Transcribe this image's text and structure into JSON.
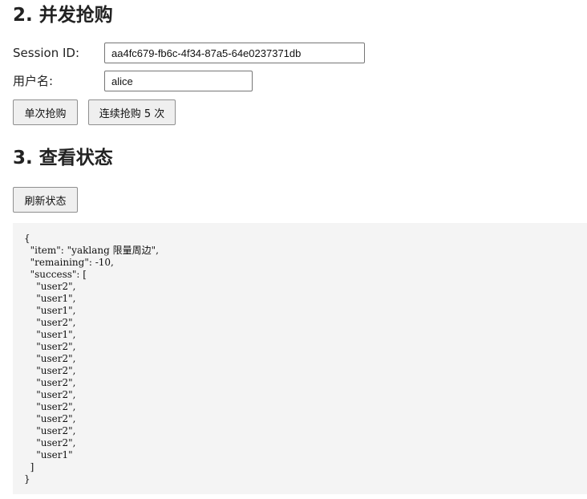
{
  "section2": {
    "title": "2. 并发抢购",
    "session_label": "Session ID:",
    "session_value": "aa4fc679-fb6c-4f34-87a5-64e0237371db",
    "username_label": "用户名:",
    "username_value": "alice",
    "single_buy_button": "单次抢购",
    "multi_buy_button": "连续抢购 5 次"
  },
  "section3": {
    "title": "3. 查看状态",
    "refresh_button": "刷新状态",
    "output": "{\n  \"item\": \"yaklang 限量周边\",\n  \"remaining\": -10,\n  \"success\": [\n    \"user2\",\n    \"user1\",\n    \"user1\",\n    \"user2\",\n    \"user1\",\n    \"user2\",\n    \"user2\",\n    \"user2\",\n    \"user2\",\n    \"user2\",\n    \"user2\",\n    \"user2\",\n    \"user2\",\n    \"user2\",\n    \"user1\"\n  ]\n}"
  }
}
